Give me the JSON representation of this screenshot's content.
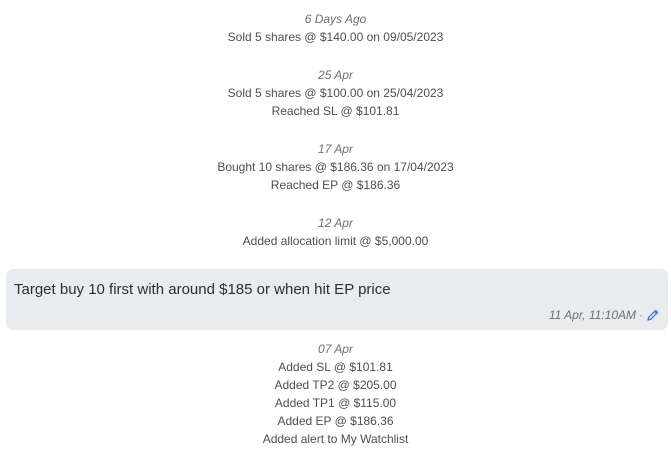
{
  "events": [
    {
      "date": "6 Days Ago",
      "lines": [
        "Sold 5 shares @ $140.00 on 09/05/2023"
      ]
    },
    {
      "date": "25 Apr",
      "lines": [
        "Sold 5 shares @ $100.00 on 25/04/2023",
        "Reached SL @ $101.81"
      ]
    },
    {
      "date": "17 Apr",
      "lines": [
        "Bought 10 shares @ $186.36 on 17/04/2023",
        "Reached EP @ $186.36"
      ]
    },
    {
      "date": "12 Apr",
      "lines": [
        "Added allocation limit @ $5,000.00"
      ]
    },
    {
      "date": "07 Apr",
      "lines": [
        "Added SL @ $101.81",
        "Added TP2 @ $205.00",
        "Added TP1 @ $115.00",
        "Added EP @ $186.36",
        "Added alert to My Watchlist"
      ]
    }
  ],
  "note": {
    "text": "Target buy 10 first with around $185 or when hit EP price",
    "timestamp": "11 Apr, 11:10AM",
    "separator": "·",
    "edit_icon": "pencil-icon"
  },
  "colors": {
    "note_background": "#e9ecef",
    "edit_icon": "#3b6fd8"
  }
}
